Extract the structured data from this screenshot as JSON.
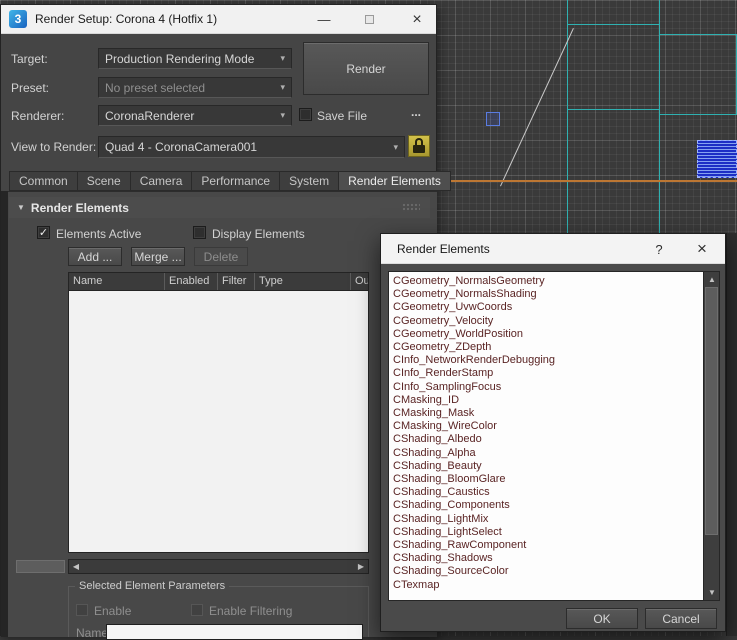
{
  "window": {
    "title": "Render Setup: Corona 4 (Hotfix 1)",
    "target_label": "Target:",
    "target_value": "Production Rendering Mode",
    "preset_label": "Preset:",
    "preset_value": "No preset selected",
    "renderer_label": "Renderer:",
    "renderer_value": "CoronaRenderer",
    "save_file_label": "Save File",
    "browse_label": "...",
    "render_button": "Render",
    "view_label": "View to Render:",
    "view_value": "Quad 4 - CoronaCamera001",
    "tabs": [
      "Common",
      "Scene",
      "Camera",
      "Performance",
      "System",
      "Render Elements"
    ],
    "rollout_title": "Render Elements",
    "elements_active_label": "Elements Active",
    "display_elements_label": "Display Elements",
    "add_button": "Add ...",
    "merge_button": "Merge ...",
    "delete_button": "Delete",
    "table_headers": [
      "Name",
      "Enabled",
      "Filter",
      "Type",
      "Ou"
    ],
    "selected_params_title": "Selected Element Parameters",
    "enable_label": "Enable",
    "enable_filtering_label": "Enable Filtering",
    "name_label": "Name:"
  },
  "popup": {
    "title": "Render Elements",
    "help_button": "?",
    "close_button": "×",
    "items": [
      "CGeometry_NormalsGeometry",
      "CGeometry_NormalsShading",
      "CGeometry_UvwCoords",
      "CGeometry_Velocity",
      "CGeometry_WorldPosition",
      "CGeometry_ZDepth",
      "CInfo_NetworkRenderDebugging",
      "CInfo_RenderStamp",
      "CInfo_SamplingFocus",
      "CMasking_ID",
      "CMasking_Mask",
      "CMasking_WireColor",
      "CShading_Albedo",
      "CShading_Alpha",
      "CShading_Beauty",
      "CShading_BloomGlare",
      "CShading_Caustics",
      "CShading_Components",
      "CShading_LightMix",
      "CShading_LightSelect",
      "CShading_RawComponent",
      "CShading_Shadows",
      "CShading_SourceColor",
      "CTexmap"
    ],
    "ok_button": "OK",
    "cancel_button": "Cancel"
  },
  "icons": {
    "app_icon": "3",
    "minimize": "—",
    "close": "×",
    "dropdown": "▾",
    "rollout_arrow": "▼",
    "check": "✓",
    "left": "◀",
    "right": "▶",
    "up": "▲",
    "down": "▼"
  },
  "colors": {
    "wireframe_teal": "#2fb1b1",
    "spline_orange": "#bd7733",
    "selection_blue": "#1d2ec5",
    "lock_active_yellow": "#c2b13e",
    "list_text": "#5a2424",
    "panel_bg": "#454545"
  }
}
